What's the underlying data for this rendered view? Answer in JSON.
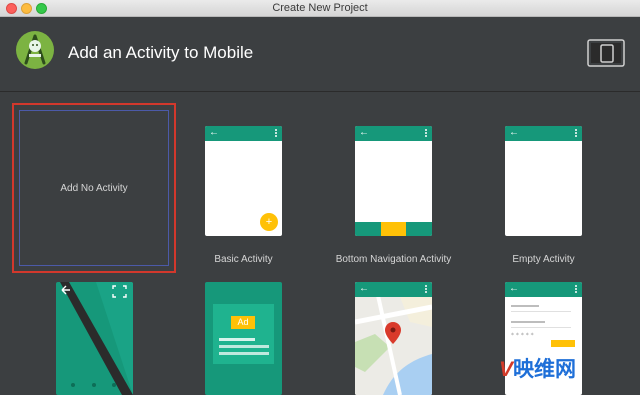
{
  "window": {
    "title": "Create New Project"
  },
  "header": {
    "title": "Add an Activity to Mobile",
    "logo_icon": "android-studio-logo-icon",
    "device_icon": "tablet-phone-icon"
  },
  "activities": [
    {
      "label": "Add No Activity",
      "selected": true
    },
    {
      "label": "Basic Activity"
    },
    {
      "label": "Bottom Navigation Activity"
    },
    {
      "label": "Empty Activity"
    }
  ],
  "ad_preview": {
    "badge": "Ad"
  },
  "watermark": {
    "text": "映维网",
    "letter": "V"
  },
  "colors": {
    "accent_teal": "#16987a",
    "fab_yellow": "#ffc107",
    "selection_red": "#d2382c"
  }
}
